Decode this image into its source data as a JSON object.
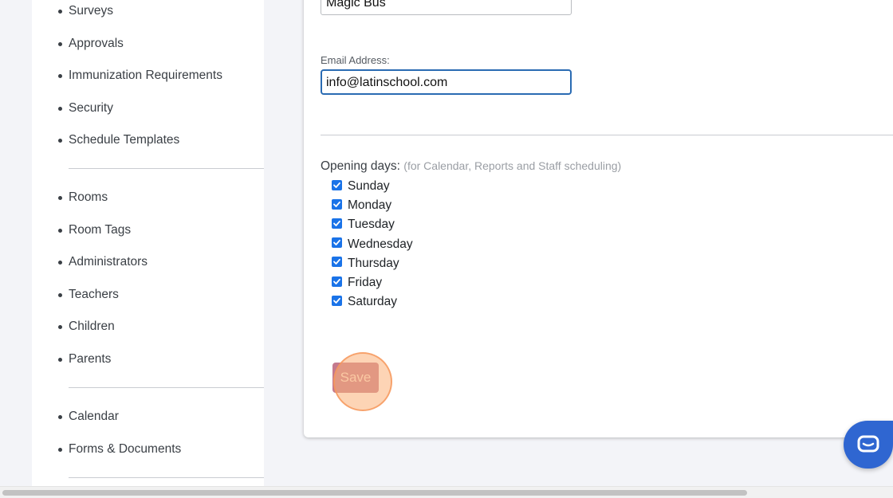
{
  "sidebar": {
    "group1": [
      "Surveys",
      "Approvals",
      "Immunization Requirements",
      "Security",
      "Schedule Templates"
    ],
    "group2": [
      "Rooms",
      "Room Tags",
      "Administrators",
      "Teachers",
      "Children",
      "Parents"
    ],
    "group3": [
      "Calendar",
      "Forms & Documents"
    ]
  },
  "form": {
    "name_value": "Magic Bus",
    "email_label": "Email Address:",
    "email_value": "info@latinschool.com",
    "opening_label": "Opening days:",
    "opening_hint": "(for Calendar, Reports and Staff scheduling)",
    "days": [
      {
        "label": "Sunday",
        "checked": true
      },
      {
        "label": "Monday",
        "checked": true
      },
      {
        "label": "Tuesday",
        "checked": true
      },
      {
        "label": "Wednesday",
        "checked": true
      },
      {
        "label": "Thursday",
        "checked": true
      },
      {
        "label": "Friday",
        "checked": true
      },
      {
        "label": "Saturday",
        "checked": true
      }
    ],
    "save_label": "Save"
  },
  "colors": {
    "checkbox": "#1a73e8",
    "chat_bubble": "#2f66d1",
    "focus_border": "#2a6bb3"
  },
  "chat": {
    "icon": "chat-icon"
  }
}
